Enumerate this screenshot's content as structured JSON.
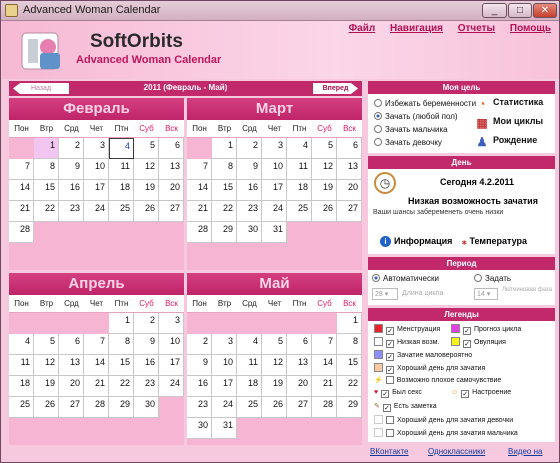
{
  "window": {
    "title": "Advanced Woman Calendar"
  },
  "header": {
    "brand": "SoftOrbits",
    "subtitle": "Advanced Woman Calendar",
    "menu": [
      "Файл",
      "Навигация",
      "Отчеты",
      "Помощь"
    ]
  },
  "nav": {
    "prev": "Назад",
    "range": "2011 (Февраль - Май)",
    "next": "Вперед"
  },
  "weekdays": [
    "Пон",
    "Втр",
    "Срд",
    "Чет",
    "Птн",
    "Суб",
    "Вск"
  ],
  "months": [
    {
      "name": "Февраль",
      "offset": 1,
      "days": 28,
      "today": 4
    },
    {
      "name": "Март",
      "offset": 1,
      "days": 31
    },
    {
      "name": "Апрель",
      "offset": 4,
      "days": 30
    },
    {
      "name": "Май",
      "offset": 6,
      "days": 31
    }
  ],
  "goal": {
    "title": "Моя цель",
    "options": [
      "Избежать беременности",
      "Зачать (любой пол)",
      "Зачать мальчика",
      "Зачать девочку"
    ],
    "selected": 1,
    "buttons": {
      "stats": "Статистика",
      "cycles": "Мои циклы",
      "birth": "Рождение"
    }
  },
  "day": {
    "title": "День",
    "today": "Сегодня 4.2.2011",
    "status": "Низкая возможность зачатия",
    "detail": "Ваши шансы забеременеть очень низки",
    "info": "Информация",
    "temp": "Температура"
  },
  "period": {
    "title": "Период",
    "auto": "Автоматически",
    "set": "Задать",
    "cycle_value": "28",
    "cycle_label": "Длина цикла",
    "luteal_value": "14",
    "luteal_label": "Лютеиновая фаза"
  },
  "legend": {
    "title": "Легенды",
    "col1": [
      "Менструация",
      "Низкая возм.",
      "Зачатие маловероятно",
      "Хороший день для зачатия",
      "Возможно плохое самочувствие",
      "Был секс",
      "Есть заметка",
      "Хороший день для зачатия девочки",
      "Хороший день для зачатия мальчика"
    ],
    "col2": [
      "Прогноз цикла",
      "Овуляция",
      "Настроение"
    ]
  },
  "footer": {
    "vk": "ВКонтакте",
    "ok": "Одноклассники",
    "video": "Видео на"
  },
  "colors": {
    "accent": "#c2296b",
    "menstruation": "#e8232c",
    "forecast": "#e53fe8",
    "low": "#ffffff",
    "ovulation": "#f5f51b",
    "unlikely": "#8f8cff",
    "good": "#f9c9a1"
  }
}
